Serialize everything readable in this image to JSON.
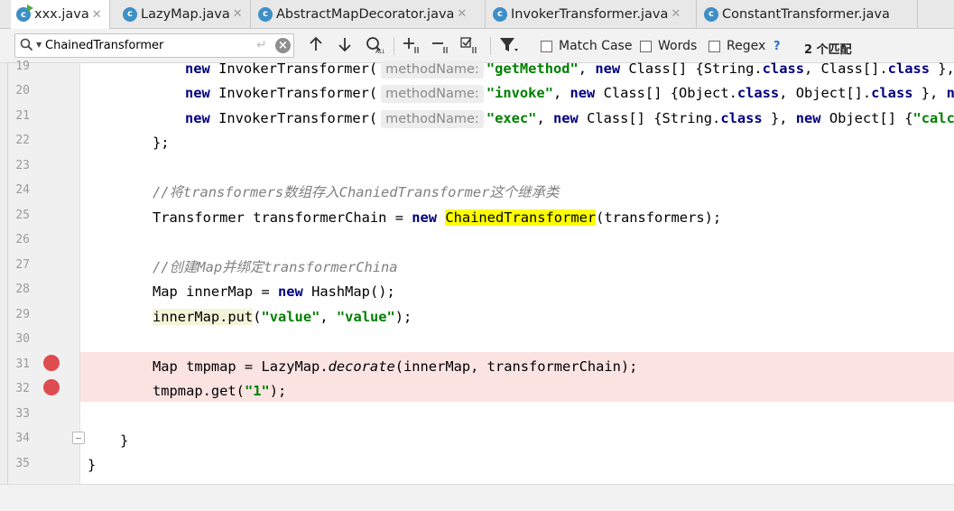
{
  "tabs": [
    {
      "label": "xxx.java",
      "icon": "java-class-icon",
      "active": true,
      "runnable": true
    },
    {
      "label": "LazyMap.java",
      "icon": "java-class-icon",
      "active": false
    },
    {
      "label": "AbstractMapDecorator.java",
      "icon": "java-class-icon",
      "active": false
    },
    {
      "label": "InvokerTransformer.java",
      "icon": "java-class-icon",
      "active": false
    },
    {
      "label": "ConstantTransformer.java",
      "icon": "java-class-icon",
      "active": false
    }
  ],
  "search": {
    "value": "ChainedTransformer",
    "match_case": "Match Case",
    "words": "Words",
    "regex": "Regex",
    "help": "?",
    "result_count": "2 个匹配"
  },
  "editor": {
    "lines": [
      {
        "number": "19",
        "breakpoint": false
      },
      {
        "number": "20",
        "breakpoint": false
      },
      {
        "number": "21",
        "breakpoint": false
      },
      {
        "number": "22",
        "breakpoint": false
      },
      {
        "number": "23",
        "breakpoint": false
      },
      {
        "number": "24",
        "breakpoint": false
      },
      {
        "number": "25",
        "breakpoint": false
      },
      {
        "number": "26",
        "breakpoint": false
      },
      {
        "number": "27",
        "breakpoint": false
      },
      {
        "number": "28",
        "breakpoint": false
      },
      {
        "number": "29",
        "breakpoint": false
      },
      {
        "number": "30",
        "breakpoint": false
      },
      {
        "number": "31",
        "breakpoint": true
      },
      {
        "number": "32",
        "breakpoint": true
      },
      {
        "number": "33",
        "breakpoint": false
      },
      {
        "number": "34",
        "breakpoint": false
      },
      {
        "number": "35",
        "breakpoint": false
      }
    ],
    "code": {
      "l19": {
        "kw_new": "new",
        "cls": "InvokerTransformer(",
        "hint": "methodName:",
        "s1": "\"getMethod\"",
        "p1": ", ",
        "kw_new2": "new",
        "t1": " Class[] {String.",
        "kw_class": "class",
        "t2": ", Class[].",
        "kw_class2": "class",
        "t3": " }, n"
      },
      "l20": {
        "kw_new": "new",
        "cls": "InvokerTransformer(",
        "hint": "methodName:",
        "s1": "\"invoke\"",
        "p1": ", ",
        "kw_new2": "new",
        "t1": " Class[] {Object.",
        "kw_class": "class",
        "t2": ", Object[].",
        "kw_class2": "class",
        "t3": " }, ",
        "kw_new3": "new"
      },
      "l21": {
        "kw_new": "new",
        "cls": "InvokerTransformer(",
        "hint": "methodName:",
        "s1": "\"exec\"",
        "p1": ", ",
        "kw_new2": "new",
        "t1": " Class[] {String.",
        "kw_class": "class",
        "t2": " }, ",
        "kw_new3": "new",
        "t3": " Object[] {",
        "s2": "\"calc.e"
      },
      "l22": {
        "text": "};"
      },
      "l24": {
        "comment": "//将transformers数组存入ChaniedTransformer这个继承类"
      },
      "l25": {
        "a": "Transformer transformerChain = ",
        "kw_new": "new",
        "sp": " ",
        "match": "ChainedTransformer",
        "b": "(transformers);"
      },
      "l27": {
        "comment": "//创建Map并绑定transformerChina"
      },
      "l28": {
        "a": "Map innerMap = ",
        "kw_new": "new",
        "b": " HashMap();"
      },
      "l29": {
        "usage": "innerMap.put",
        "a": "(",
        "s1": "\"value\"",
        "p": ", ",
        "s2": "\"value\"",
        "b": ");"
      },
      "l31": {
        "a": "Map tmpmap = LazyMap.",
        "method": "decorate",
        "b": "(innerMap, transformerChain);"
      },
      "l32": {
        "a": "tmpmap.get(",
        "s1": "\"1\"",
        "b": ");"
      },
      "l34": {
        "text": "}"
      },
      "l35": {
        "text": "}"
      }
    }
  },
  "colors": {
    "keyword": "#000080",
    "string": "#008000",
    "comment": "#808080",
    "search_highlight": "#fefe00",
    "breakpoint": "#de4c4f",
    "breakpoint_line": "#fae3e1"
  }
}
